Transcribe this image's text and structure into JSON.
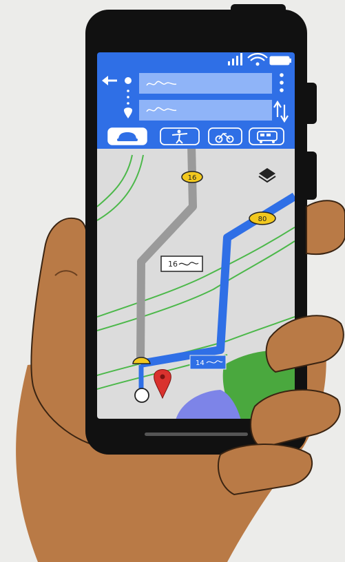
{
  "colors": {
    "background": "#ececea",
    "phone_body": "#111111",
    "header_blue": "#2f6fe6",
    "input_blue": "#8fb4f8",
    "map_bg": "#dcdcdc",
    "road_gray": "#9a9a9a",
    "route_blue": "#2f6fe6",
    "park_green": "#4aa83e",
    "water_purple": "#7d84e8",
    "skin": "#b97a46",
    "pin_red": "#d9322e",
    "shield_yellow": "#f2c81e"
  },
  "status_bar": {
    "icons": [
      "signal-icon",
      "wifi-icon",
      "battery-icon"
    ]
  },
  "search": {
    "origin_placeholder": "",
    "destination_placeholder": ""
  },
  "transport_modes": [
    {
      "name": "car",
      "selected": true
    },
    {
      "name": "walk",
      "selected": false
    },
    {
      "name": "bike",
      "selected": false
    },
    {
      "name": "transit",
      "selected": false
    }
  ],
  "map": {
    "shield_16": "16",
    "shield_80": "80",
    "label_gray_route": "16",
    "label_blue_route": "14",
    "icons": [
      "layers-icon",
      "destination-pin-icon",
      "origin-dot-icon"
    ]
  }
}
